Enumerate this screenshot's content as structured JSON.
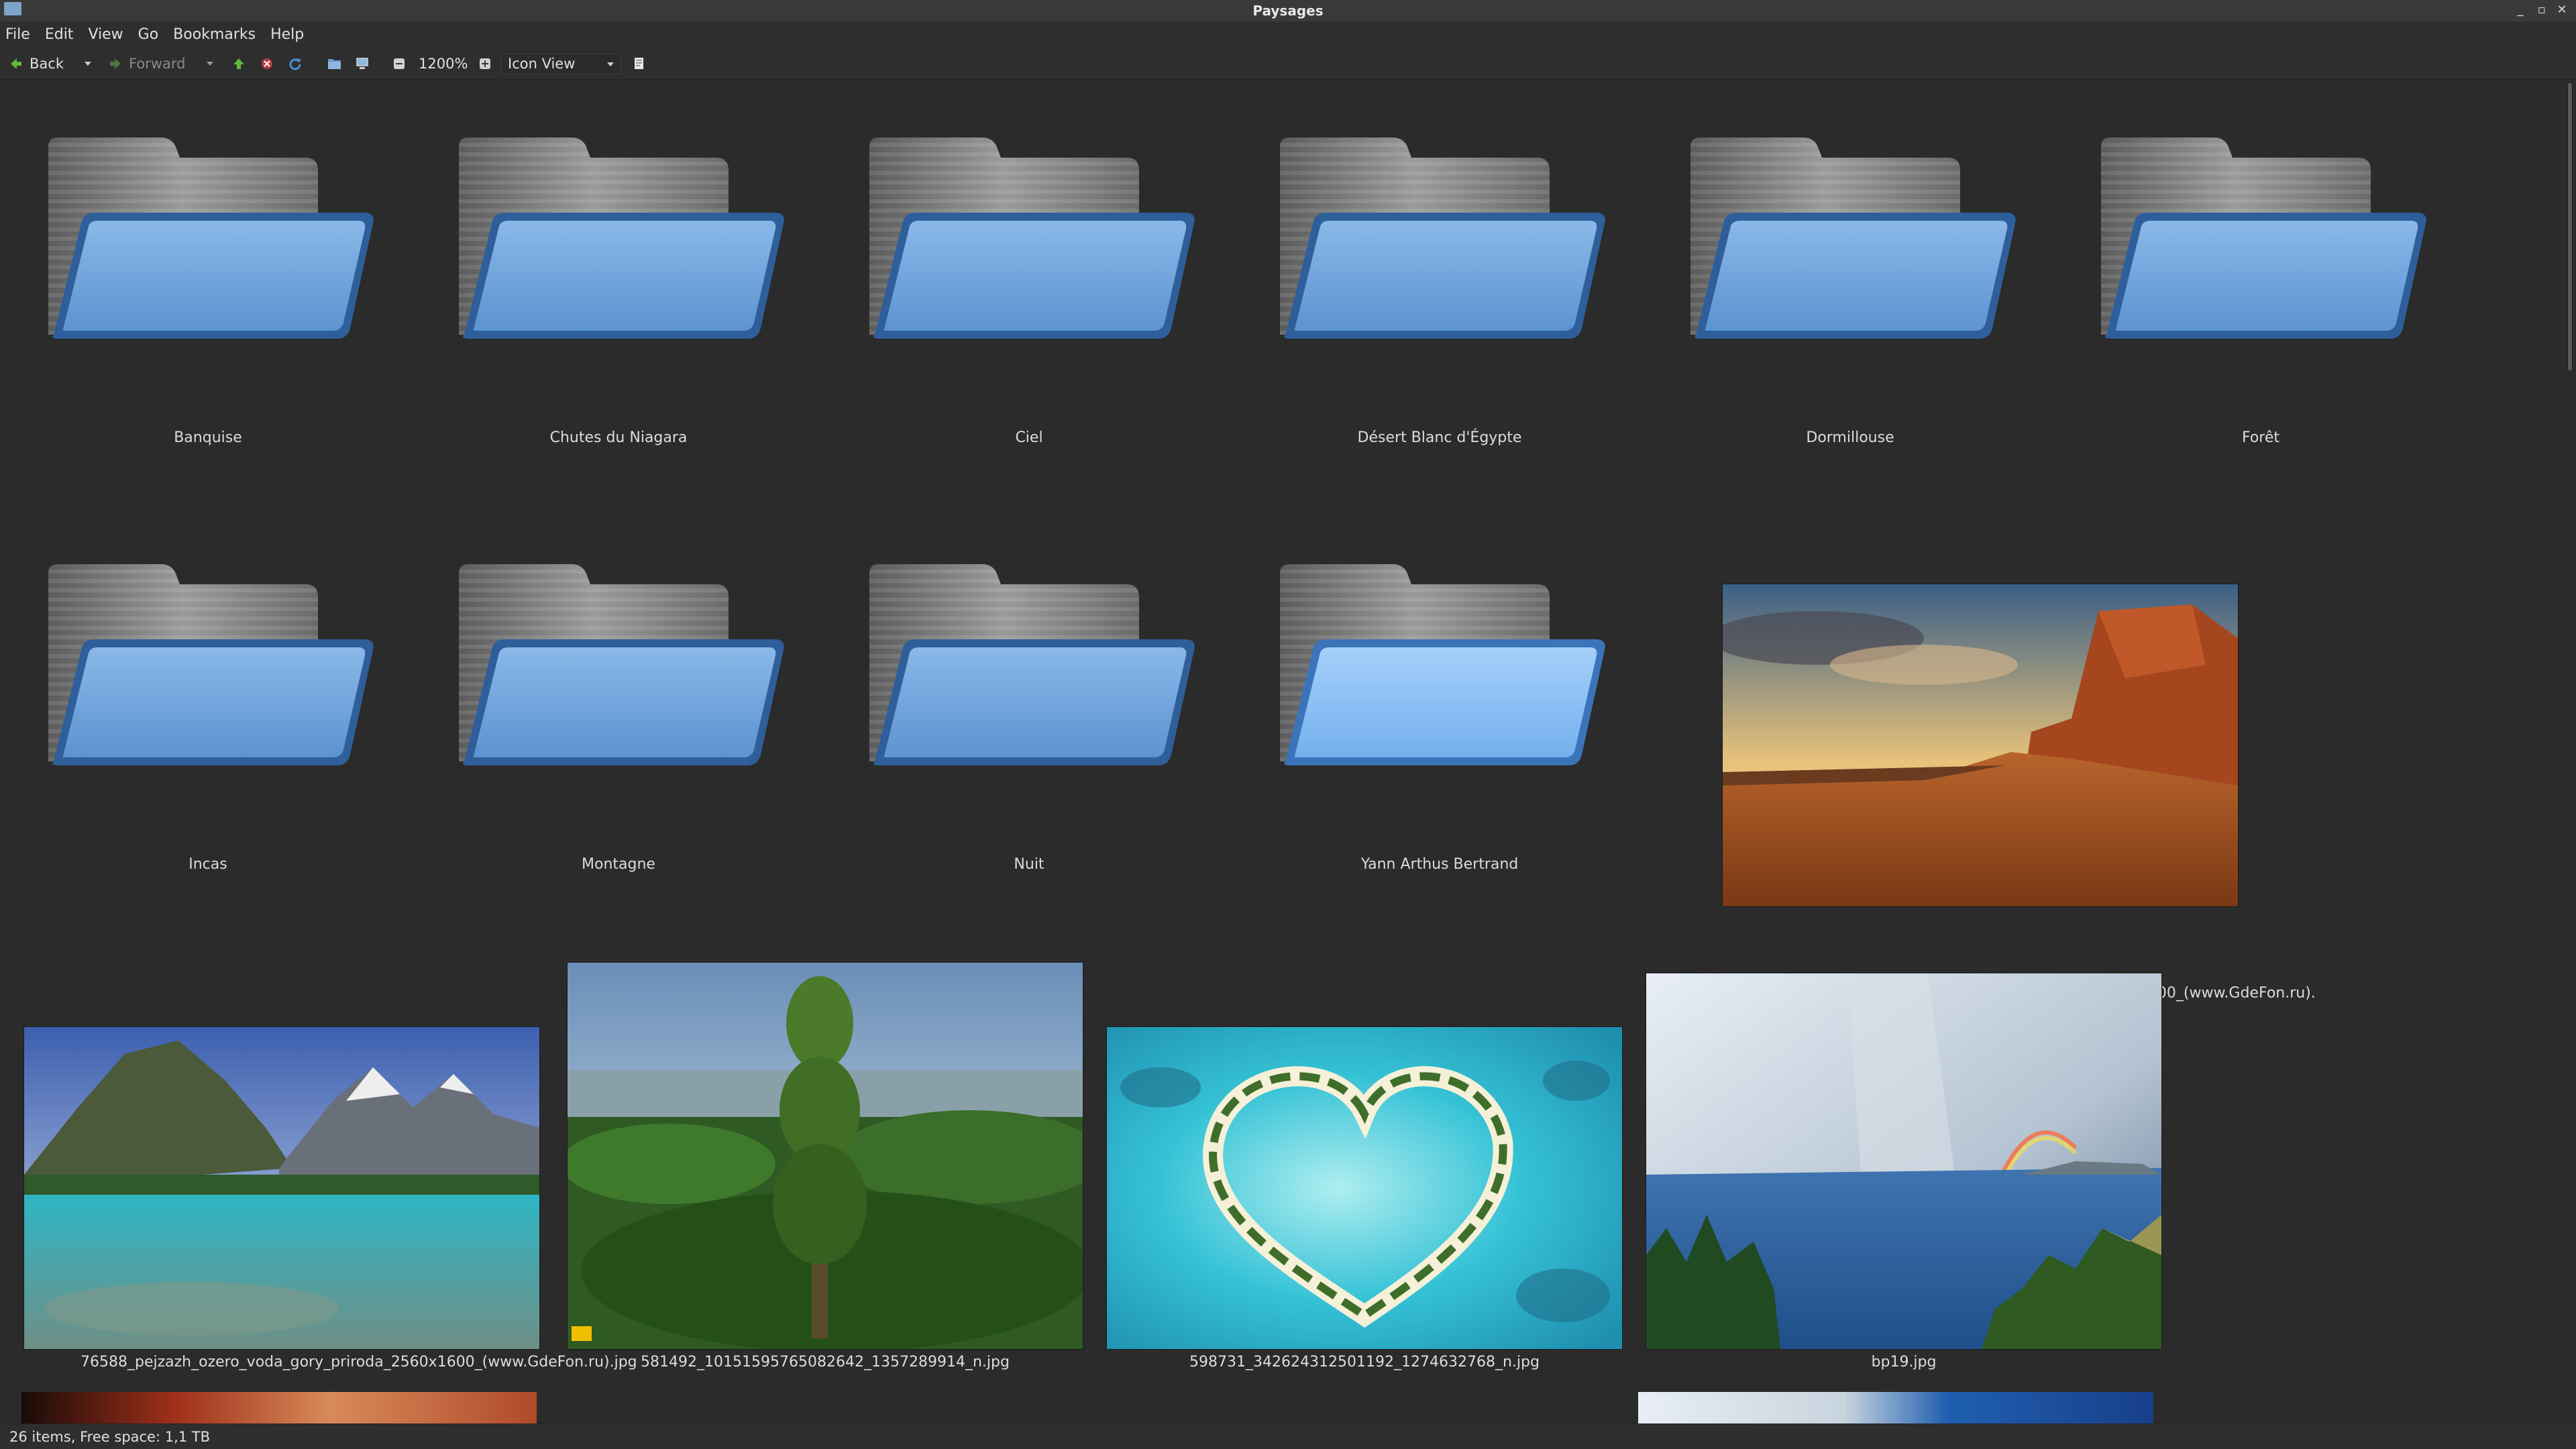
{
  "window": {
    "title": "Paysages"
  },
  "menubar": {
    "items": [
      "File",
      "Edit",
      "View",
      "Go",
      "Bookmarks",
      "Help"
    ]
  },
  "toolbar": {
    "back_label": "Back",
    "forward_label": "Forward",
    "zoom_label": "1200%",
    "view_mode": "Icon View"
  },
  "folders": [
    {
      "name": "Banquise"
    },
    {
      "name": "Chutes du Niagara"
    },
    {
      "name": "Ciel"
    },
    {
      "name": "Désert Blanc d'Égypte"
    },
    {
      "name": "Dormillouse"
    },
    {
      "name": "Forêt"
    },
    {
      "name": "Incas"
    },
    {
      "name": "Montagne"
    },
    {
      "name": "Nuit"
    },
    {
      "name": "Yann Arthus Bertrand"
    }
  ],
  "images": [
    {
      "name": "73027_skaly_gory_pustynya_pejzazh_nebo_oblaka_amerika_1920x1200_(www.GdeFon.ru).jpg"
    },
    {
      "name": "76588_pejzazh_ozero_voda_gory_priroda_2560x1600_(www.GdeFon.ru).jpg"
    },
    {
      "name": "581492_10151595765082642_1357289914_n.jpg"
    },
    {
      "name": "598731_342624312501192_1274632768_n.jpg"
    },
    {
      "name": "bp19.jpg"
    }
  ],
  "statusbar": {
    "text": "26 items, Free space: 1,1  TB"
  }
}
